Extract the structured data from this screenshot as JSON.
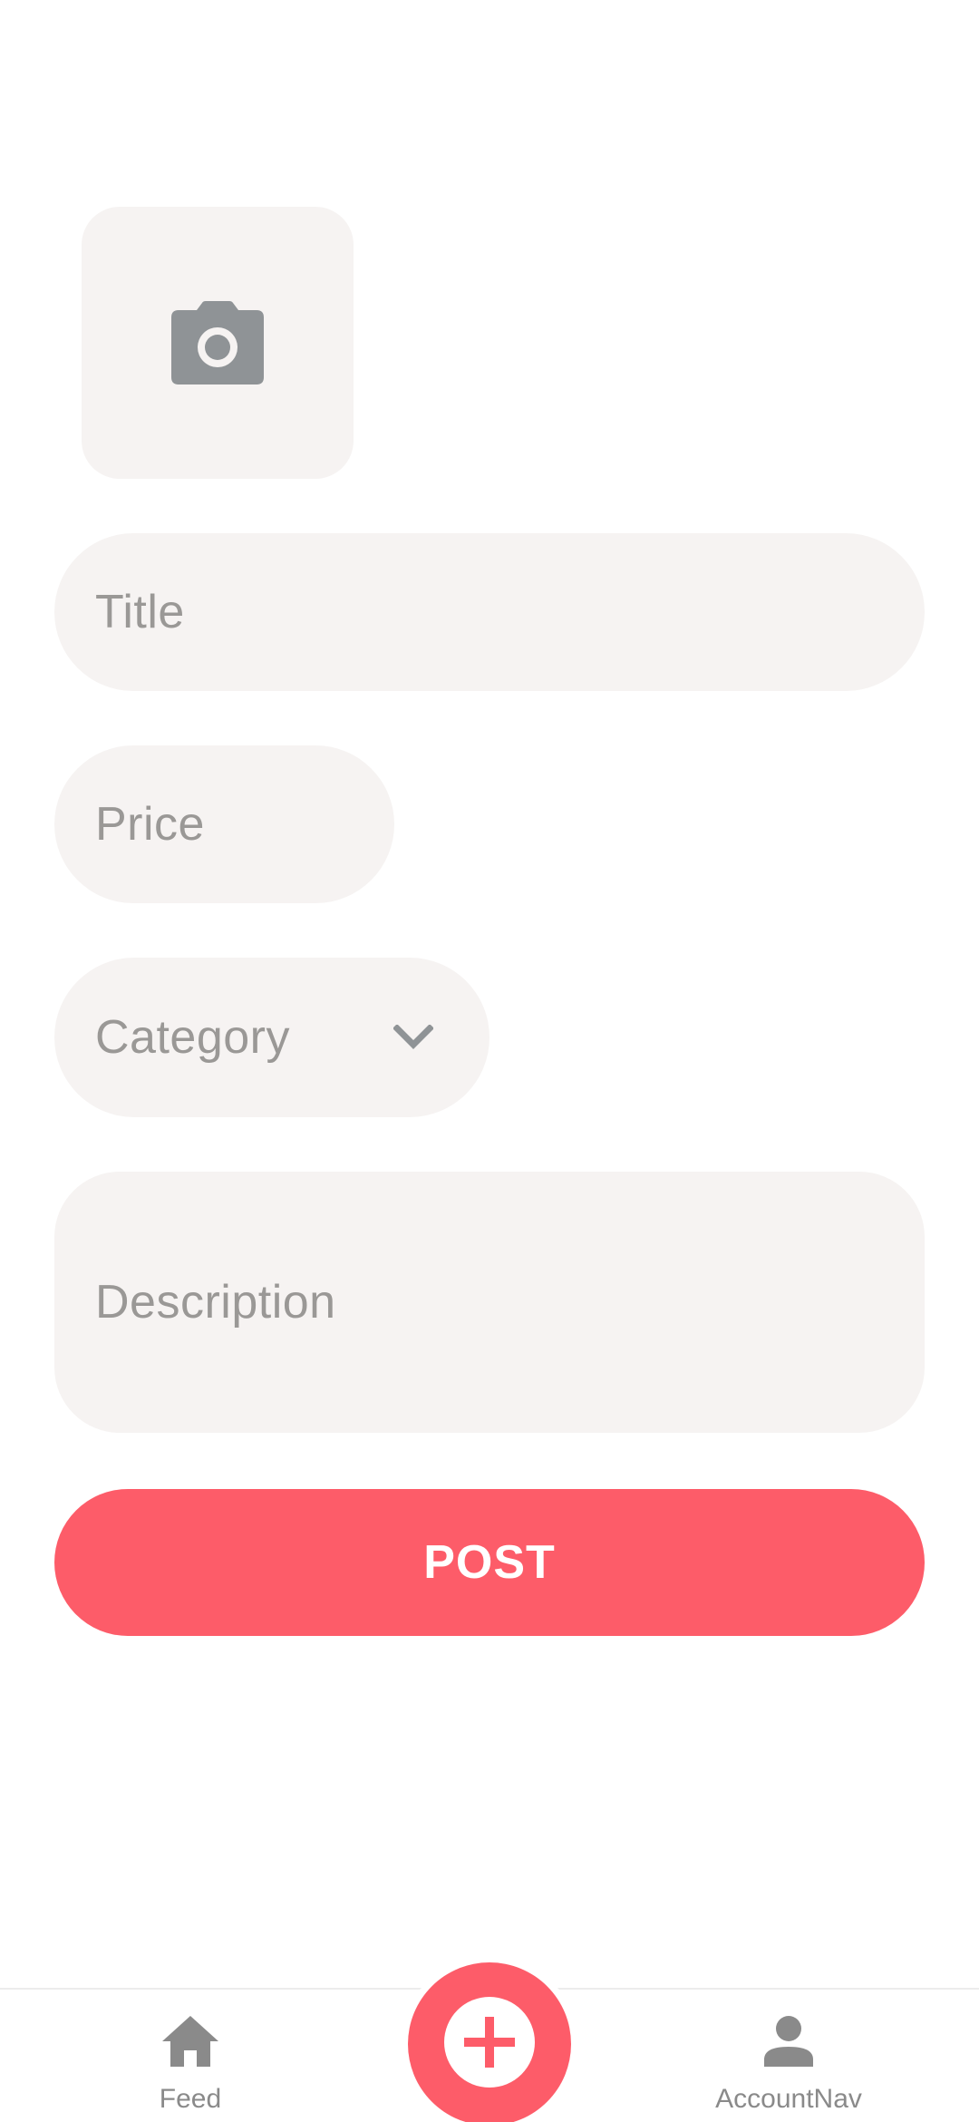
{
  "form": {
    "image_picker_icon": "camera-icon",
    "title_placeholder": "Title",
    "price_placeholder": "Price",
    "category_placeholder": "Category",
    "category_icon": "chevron-down-icon",
    "description_placeholder": "Description",
    "post_label": "POST"
  },
  "tab_bar": {
    "items": [
      {
        "label": "Feed",
        "icon": "home-icon"
      },
      {
        "label": "AccountNav",
        "icon": "person-icon"
      }
    ],
    "fab_icon": "plus-icon"
  },
  "colors": {
    "accent": "#fd5c69",
    "field_background": "#f6f3f2",
    "placeholder_text": "#9a9896",
    "icon_gray": "#8f9396"
  }
}
